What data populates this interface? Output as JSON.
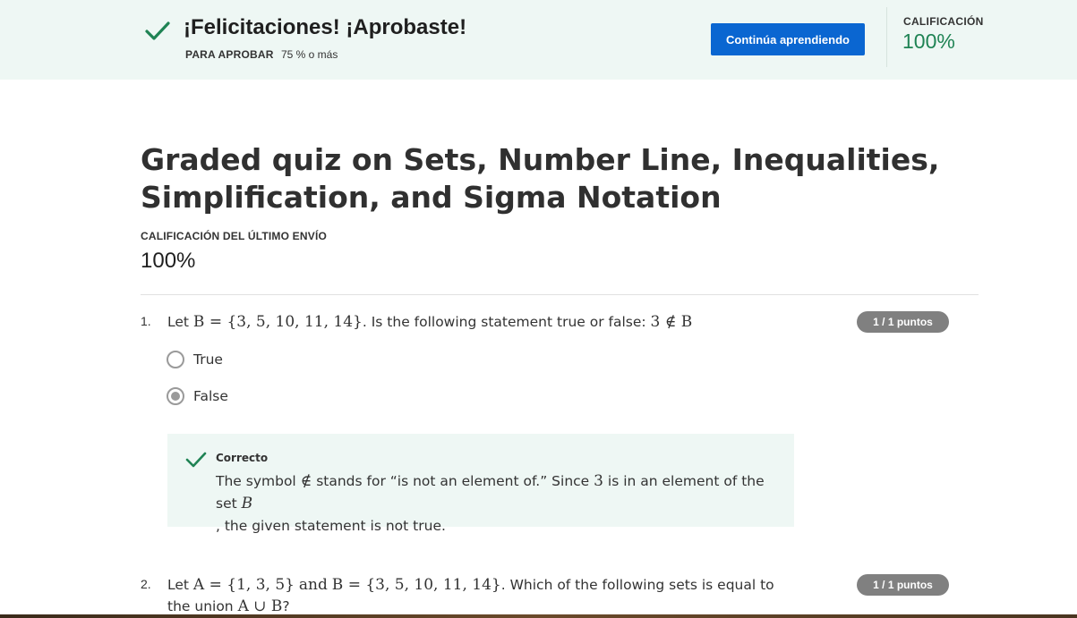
{
  "banner": {
    "title": "¡Felicitaciones! ¡Aprobaste!",
    "pass_label": "PARA APROBAR",
    "pass_value": "75 % o más",
    "cta_label": "Continúa aprendiendo",
    "grade_label": "CALIFICACIÓN",
    "grade_value": "100%"
  },
  "quiz": {
    "title": "Graded quiz on Sets, Number Line, Inequalities, Simplification, and Sigma Notation",
    "last_grade_label": "CALIFICACIÓN DEL ÚLTIMO ENVÍO",
    "last_grade_value": "100%"
  },
  "questions": [
    {
      "number": "1.",
      "prefix": "Let",
      "math1": "B = {3, 5, 10, 11, 14}",
      "middle": ". Is the following statement true or false: ",
      "math2": "3 ∉ B",
      "points": "1 / 1 puntos",
      "options": [
        {
          "label": "True",
          "selected": false
        },
        {
          "label": "False",
          "selected": true
        }
      ],
      "feedback": {
        "label": "Correcto",
        "t1": "The symbol ",
        "m1": "∉",
        "t2": " stands for “is not an element of.” Since ",
        "m2": "3",
        "t3": " is in an element of the set ",
        "m3": "B",
        "t4": ", the given statement is not true."
      }
    },
    {
      "number": "2.",
      "prefix": "Let",
      "math1": "A = {1, 3, 5}",
      "and": "and",
      "math2": "B = {3, 5, 10, 11, 14}",
      "middle": ". Which of the following sets is equal to the union ",
      "math3": "A ∪ B",
      "end": "?",
      "points": "1 / 1 puntos"
    }
  ],
  "colors": {
    "banner_bg": "#eef7f4",
    "accent_green": "#1f8354",
    "button_blue": "#0a66d1",
    "badge_gray": "#808080"
  },
  "icons": [
    "checkmark-icon",
    "radio-icon"
  ]
}
